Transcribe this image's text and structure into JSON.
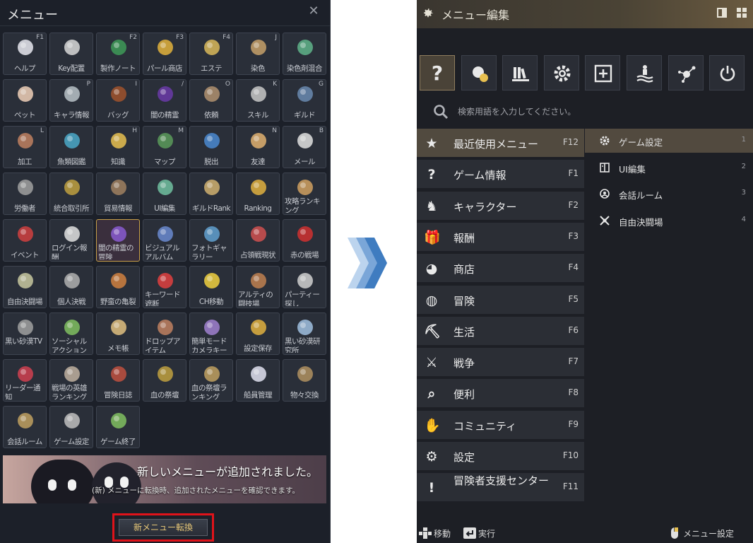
{
  "left_panel": {
    "title": "メニュー",
    "close_glyph": "✕",
    "tiles": [
      {
        "label": "ヘルプ",
        "key": "F1",
        "icon": "help-icon",
        "color": "#e8e8f0"
      },
      {
        "label": "Key配置",
        "key": "",
        "icon": "keyboard-icon",
        "color": "#d8d8d8"
      },
      {
        "label": "製作ノート",
        "key": "F2",
        "icon": "craft-note-icon",
        "color": "#3e9a58"
      },
      {
        "label": "パール商店",
        "key": "F3",
        "icon": "pearl-shop-icon",
        "color": "#e2b23c"
      },
      {
        "label": "エステ",
        "key": "F4",
        "icon": "beauty-comb-icon",
        "color": "#d9b85a"
      },
      {
        "label": "染色",
        "key": "J",
        "icon": "palette-icon",
        "color": "#c6a06a"
      },
      {
        "label": "染色剤混合",
        "key": "",
        "icon": "dye-bowl-icon",
        "color": "#5fb38a"
      },
      {
        "label": "ペット",
        "key": "",
        "icon": "paw-icon",
        "color": "#f0d0b8"
      },
      {
        "label": "キャラ情報",
        "key": "P",
        "icon": "armor-icon",
        "color": "#b8c2c8"
      },
      {
        "label": "バッグ",
        "key": "I",
        "icon": "bag-icon",
        "color": "#a0522d"
      },
      {
        "label": "闇の精霊",
        "key": "/",
        "icon": "dark-spirit-icon",
        "color": "#6a3aa8"
      },
      {
        "label": "依頼",
        "key": "O",
        "icon": "scroll-icon",
        "color": "#b09070"
      },
      {
        "label": "スキル",
        "key": "K",
        "icon": "crossed-swords-icon",
        "color": "#c8c8c8"
      },
      {
        "label": "ギルド",
        "key": "G",
        "icon": "guild-shield-icon",
        "color": "#6a8ab0"
      },
      {
        "label": "加工",
        "key": "L",
        "icon": "hammer-icon",
        "color": "#c08060"
      },
      {
        "label": "魚類図鑑",
        "key": "",
        "icon": "fish-icon",
        "color": "#4aa8c8"
      },
      {
        "label": "知識",
        "key": "H",
        "icon": "knowledge-head-icon",
        "color": "#e8c050"
      },
      {
        "label": "マップ",
        "key": "M",
        "icon": "globe-icon",
        "color": "#5a9a5a"
      },
      {
        "label": "脱出",
        "key": "",
        "icon": "escape-icon",
        "color": "#4a88d0"
      },
      {
        "label": "友達",
        "key": "N",
        "icon": "handshake-icon",
        "color": "#e0b070"
      },
      {
        "label": "メール",
        "key": "B",
        "icon": "mail-icon",
        "color": "#e0e0e0"
      },
      {
        "label": "労働者",
        "key": "",
        "icon": "pickaxe-icon",
        "color": "#a0a0a0"
      },
      {
        "label": "統合取引所",
        "key": "",
        "icon": "money-bag-icon",
        "color": "#c0a040"
      },
      {
        "label": "貿易情報",
        "key": "",
        "icon": "wagon-icon",
        "color": "#a08060"
      },
      {
        "label": "UI編集",
        "key": "",
        "icon": "move-arrows-icon",
        "color": "#70c0a0"
      },
      {
        "label": "ギルドRank",
        "key": "",
        "icon": "laurel-icon",
        "color": "#d0b070"
      },
      {
        "label": "Ranking",
        "key": "",
        "icon": "trophy-icon",
        "color": "#e0b040"
      },
      {
        "label": "攻略ランキング",
        "key": "",
        "icon": "clock-icon",
        "color": "#d0a060"
      },
      {
        "label": "イベント",
        "key": "",
        "icon": "gift-icon",
        "color": "#d04040"
      },
      {
        "label": "ログイン報酬",
        "key": "",
        "icon": "calendar-icon",
        "color": "#e0e0e0"
      },
      {
        "label": "闇の精霊の冒険",
        "key": "",
        "icon": "dice-icon",
        "color": "#8a5ad0"
      },
      {
        "label": "ビジュアルアルバム",
        "key": "",
        "icon": "album-icon",
        "color": "#6a8ad0"
      },
      {
        "label": "フォトギャラリー",
        "key": "",
        "icon": "photo-icon",
        "color": "#60a0d0"
      },
      {
        "label": "占領戦現状",
        "key": "",
        "icon": "siege-banner-icon",
        "color": "#d05050"
      },
      {
        "label": "赤の戦場",
        "key": "",
        "icon": "red-battlefield-icon",
        "color": "#d03030"
      },
      {
        "label": "自由決闘場",
        "key": "",
        "icon": "duel-swords-icon",
        "color": "#c8c8a0"
      },
      {
        "label": "個人決戦",
        "key": "",
        "icon": "helmet-icon",
        "color": "#b0b0b0"
      },
      {
        "label": "野蛮の亀裂",
        "key": "",
        "icon": "rift-icon",
        "color": "#d08040"
      },
      {
        "label": "キーワード遮断",
        "key": "",
        "icon": "block-icon",
        "color": "#e04040"
      },
      {
        "label": "CH移動",
        "key": "",
        "icon": "channel-icon",
        "color": "#f0d040"
      },
      {
        "label": "アルティの闘技場",
        "key": "",
        "icon": "arena-icon",
        "color": "#c08050"
      },
      {
        "label": "パーティー探し",
        "key": "",
        "icon": "party-icon",
        "color": "#d0d0d0"
      },
      {
        "label": "黒い砂漠TV",
        "key": "",
        "icon": "tv-icon",
        "color": "#a0a0a0"
      },
      {
        "label": "ソーシャルアクション",
        "key": "",
        "icon": "smile-icon",
        "color": "#80c060"
      },
      {
        "label": "メモ帳",
        "key": "",
        "icon": "memo-icon",
        "color": "#e0c080"
      },
      {
        "label": "ドロップアイテム",
        "key": "",
        "icon": "drop-item-icon",
        "color": "#c08060"
      },
      {
        "label": "簡単モードカメラキー",
        "key": "",
        "icon": "camera-key-icon",
        "color": "#a080d0"
      },
      {
        "label": "設定保存",
        "key": "",
        "icon": "folder-gear-icon",
        "color": "#e0b040"
      },
      {
        "label": "黒い砂漠研究所",
        "key": "",
        "icon": "lab-icon",
        "color": "#a0c0e0"
      },
      {
        "label": "リーダー通知",
        "key": "",
        "icon": "leader-alert-icon",
        "color": "#d04050"
      },
      {
        "label": "戦場の英雄ランキング",
        "key": "",
        "icon": "viking-helmet-icon",
        "color": "#c0b0a0"
      },
      {
        "label": "冒険日誌",
        "key": "",
        "icon": "bookshelf-icon",
        "color": "#c05040"
      },
      {
        "label": "血の祭壇",
        "key": "",
        "icon": "altar-icon",
        "color": "#c0a040"
      },
      {
        "label": "血の祭壇ランキング",
        "key": "",
        "icon": "altar-trophy-icon",
        "color": "#c0a060"
      },
      {
        "label": "船員管理",
        "key": "",
        "icon": "sailor-hat-icon",
        "color": "#e0e0f0"
      },
      {
        "label": "物々交換",
        "key": "",
        "icon": "barter-box-icon",
        "color": "#b09060"
      },
      {
        "label": "会話ルーム",
        "key": "",
        "icon": "chat-room-icon",
        "color": "#c0a060"
      },
      {
        "label": "ゲーム設定",
        "key": "",
        "icon": "gear-icon",
        "color": "#c0c0c0"
      },
      {
        "label": "ゲーム終了",
        "key": "",
        "icon": "exit-door-icon",
        "color": "#80c060"
      }
    ],
    "banner": {
      "title": "新しいメニューが追加されました。",
      "subtitle": "(新) メニューに転換時、追加されたメニューを確認できます。"
    },
    "switch_button": "新メニュー転換"
  },
  "right_panel": {
    "title": "メニュー編集",
    "search_placeholder": "検索用語を入力してください。",
    "top_icons": [
      {
        "icon": "help-icon",
        "glyph": "?"
      },
      {
        "icon": "shop-icon",
        "glyph": ""
      },
      {
        "icon": "books-icon",
        "glyph": ""
      },
      {
        "icon": "gear-icon",
        "glyph": ""
      },
      {
        "icon": "plus-box-icon",
        "glyph": ""
      },
      {
        "icon": "escape-icon",
        "glyph": ""
      },
      {
        "icon": "network-icon",
        "glyph": ""
      },
      {
        "icon": "power-icon",
        "glyph": ""
      }
    ],
    "categories": [
      {
        "label": "最近使用メニュー",
        "key": "F12",
        "icon": "bookmark-star-icon",
        "glyph": "★"
      },
      {
        "label": "ゲーム情報",
        "key": "F1",
        "icon": "help-icon",
        "glyph": "?"
      },
      {
        "label": "キャラクター",
        "key": "F2",
        "icon": "character-icon",
        "glyph": "♞"
      },
      {
        "label": "報酬",
        "key": "F3",
        "icon": "gift-icon",
        "glyph": "🎁"
      },
      {
        "label": "商店",
        "key": "F4",
        "icon": "shop-icon",
        "glyph": "◕"
      },
      {
        "label": "冒険",
        "key": "F5",
        "icon": "globe-icon",
        "glyph": "◍"
      },
      {
        "label": "生活",
        "key": "F6",
        "icon": "pickaxe-icon",
        "glyph": "⛏"
      },
      {
        "label": "戦争",
        "key": "F7",
        "icon": "war-shield-icon",
        "glyph": "⚔"
      },
      {
        "label": "便利",
        "key": "F8",
        "icon": "search-icon",
        "glyph": "⌕"
      },
      {
        "label": "コミュニティ",
        "key": "F9",
        "icon": "handshake-icon",
        "glyph": "✋"
      },
      {
        "label": "設定",
        "key": "F10",
        "icon": "gear-icon",
        "glyph": "⚙"
      },
      {
        "label": "冒険者支援センター",
        "key": "F11",
        "icon": "support-alert-icon",
        "glyph": "!"
      }
    ],
    "subitems": [
      {
        "label": "ゲーム設定",
        "num": "1",
        "icon": "gear-icon"
      },
      {
        "label": "UI編集",
        "num": "2",
        "icon": "ui-edit-icon"
      },
      {
        "label": "会話ルーム",
        "num": "3",
        "icon": "chat-room-icon"
      },
      {
        "label": "自由決闘場",
        "num": "4",
        "icon": "duel-swords-icon"
      }
    ],
    "footer": {
      "move": "移動",
      "execute": "実行",
      "settings": "メニュー設定"
    }
  }
}
